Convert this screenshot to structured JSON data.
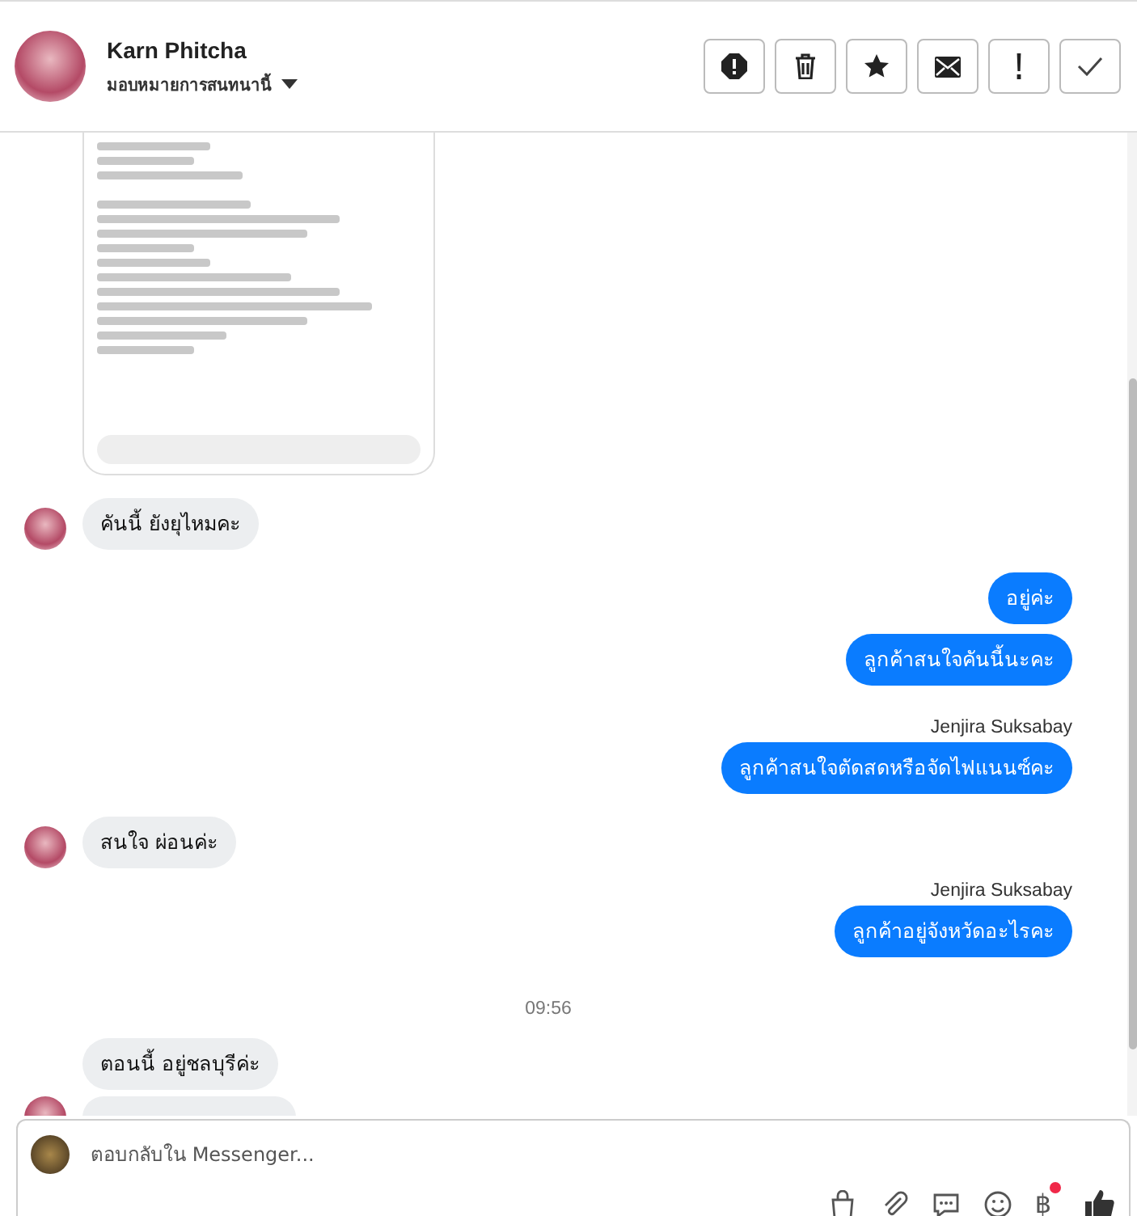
{
  "header": {
    "name": "Karn Phitcha",
    "assign": "มอบหมายการสนทนานี้"
  },
  "messages": [
    {
      "kind": "image"
    },
    {
      "kind": "in",
      "text": "คันนี้ ยังยุไหมคะ",
      "avatar": true
    },
    {
      "kind": "out",
      "text": "อยู่ค่ะ"
    },
    {
      "kind": "out",
      "text": "ลูกค้าสนใจคันนี้นะคะ"
    },
    {
      "kind": "sender",
      "text": "Jenjira Suksabay"
    },
    {
      "kind": "out",
      "text": "ลูกค้าสนใจตัดสดหรือจัดไฟแนนซ์คะ"
    },
    {
      "kind": "in",
      "text": "สนใจ ผ่อนค่ะ",
      "avatar": true
    },
    {
      "kind": "sender",
      "text": "Jenjira Suksabay"
    },
    {
      "kind": "out",
      "text": "ลูกค้าอยู่จังหวัดอะไรคะ"
    },
    {
      "kind": "time",
      "text": "09:56"
    },
    {
      "kind": "in",
      "text": "ตอนนี้ อยู่ชลบุรีค่ะ",
      "avatar": false
    },
    {
      "kind": "cut",
      "avatar": true
    }
  ],
  "composer": {
    "placeholder": "ตอบกลับใน Messenger...",
    "currency_symbol": "฿",
    "currency_badge": true
  }
}
